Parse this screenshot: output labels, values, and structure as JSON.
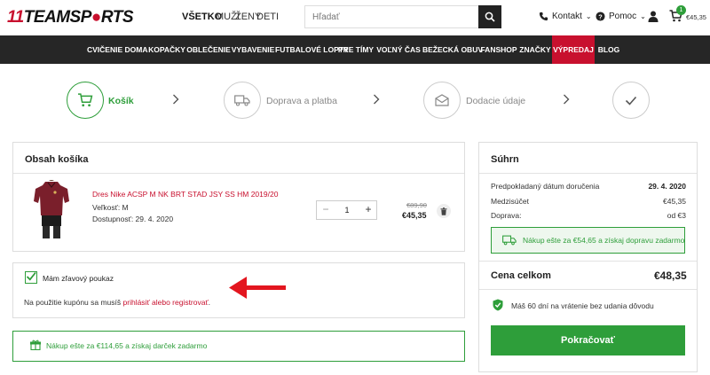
{
  "header": {
    "logo_left": "11",
    "logo_mid": "TEAMSP",
    "logo_right": "RTS",
    "genders": [
      "VŠETKO",
      "MUŽI",
      "ŽENY",
      "DETI"
    ],
    "search_placeholder": "Hľadať",
    "contact_label": "Kontakt",
    "help_label": "Pomoc",
    "cart_count": "1",
    "cart_total": "€45,35"
  },
  "nav": {
    "items": [
      "CVIČENIE DOMA",
      "KOPAČKY",
      "OBLEČENIE",
      "VYBAVENIE",
      "FUTBALOVÉ LOPTY",
      "PRE TÍMY",
      "VOĽNÝ ČAS",
      "BEŽECKÁ OBUV",
      "FANSHOP",
      "ZNAČKY",
      "VÝPREDAJ",
      "BLOG"
    ]
  },
  "steps": [
    {
      "label": "Košík",
      "icon": "cart-icon"
    },
    {
      "label": "Doprava a platba",
      "icon": "truck-icon"
    },
    {
      "label": "Dodacie údaje",
      "icon": "envelope-icon"
    },
    {
      "label": "",
      "icon": "check-icon"
    }
  ],
  "cart": {
    "title": "Obsah košíka",
    "product": {
      "name": "Dres Nike ACSP M NK BRT STAD JSY SS HM 2019/20",
      "size": "Veľkosť: M",
      "availability": "Dostupnosť: 29. 4. 2020",
      "quantity": "1",
      "qty_minus": "−",
      "qty_plus": "+",
      "price_old": "€89,90",
      "price_new": "€45,35"
    }
  },
  "coupon": {
    "label": "Mám zľavový poukaz",
    "text_before": "Na použitie kupónu sa musíš ",
    "link_text": "prihlásiť alebo registrovať",
    "text_after": "."
  },
  "gift": {
    "text_before": "Nákup ešte za ",
    "amount": "€114,65",
    "text_after": " a získaj darček zadarmo"
  },
  "summary": {
    "title": "Súhrn",
    "rows": [
      {
        "label": "Predpokladaný dátum doručenia",
        "value": "29. 4. 2020"
      },
      {
        "label": "Medzisúčet",
        "value": "€45,35"
      },
      {
        "label": "Doprava:",
        "value": "od €3"
      }
    ],
    "shipping_note_before": "Nákup ešte za ",
    "shipping_amount": "€54,65",
    "shipping_note_after": " a získaj dopravu zadarmo",
    "total_label": "Cena celkom",
    "total_value": "€48,35",
    "return_text": "Máš 60 dní na vrátenie bez udania dôvodu",
    "cta_label": "Pokračovať"
  },
  "colors": {
    "accent_green": "#2e9e3a",
    "brand_red": "#c8102e",
    "nav_bg": "#262626"
  }
}
